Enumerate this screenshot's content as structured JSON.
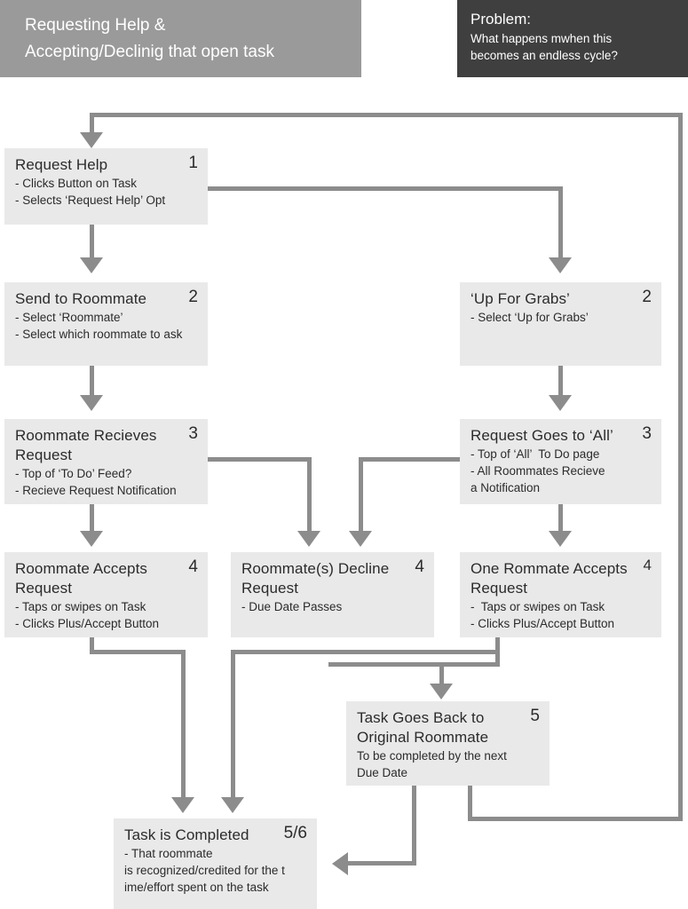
{
  "headers": {
    "left": {
      "line1": "Requesting Help &",
      "line2": "Accepting/Declinig that open task"
    },
    "right": {
      "title": "Problem:",
      "line1": "What happens mwhen this",
      "line2": "becomes an endless cycle?"
    }
  },
  "colors": {
    "header_left_bg": "#9a9a9a",
    "header_right_bg": "#3f3f3f",
    "box_bg": "#e9e9e9",
    "connector": "#8c8c8c",
    "text": "#2b2b2b"
  },
  "nodes": [
    {
      "id": "request-help",
      "number": "1",
      "title": "Request Help",
      "lines": [
        "- Clicks Button on Task",
        "- Selects ‘Request Help’ Opt"
      ]
    },
    {
      "id": "send-to-roommate",
      "number": "2",
      "title": "Send to Roommate",
      "lines": [
        "- Select ‘Roommate’",
        "- Select which roommate to ask"
      ]
    },
    {
      "id": "up-for-grabs",
      "number": "2",
      "title": "‘Up For Grabs’",
      "lines": [
        "- Select ‘Up for Grabs’"
      ]
    },
    {
      "id": "roommate-recieves-request",
      "number": "3",
      "title": "Roommate Recieves",
      "title2": "Request",
      "lines": [
        "- Top of ‘To Do’ Feed?",
        "- Recieve Request Notification"
      ]
    },
    {
      "id": "request-goes-to-all",
      "number": "3",
      "title": "Request Goes to ‘All’",
      "lines": [
        "- Top of ‘All’  To Do page",
        "- All Roommates Recieve",
        "a Notification"
      ]
    },
    {
      "id": "roommate-accepts-request",
      "number": "4",
      "title": "Roommate Accepts",
      "title2": "Request",
      "lines": [
        "- Taps or swipes on Task",
        "- Clicks Plus/Accept Button"
      ]
    },
    {
      "id": "roommates-decline-request",
      "number": "4",
      "title": "Roommate(s) Decline",
      "title2": "Request",
      "lines": [
        "- Due Date Passes"
      ]
    },
    {
      "id": "one-rommate-accepts-request",
      "number": "4",
      "title": "One Rommate Accepts",
      "title2": "Request",
      "lines": [
        "-  Taps or swipes on Task",
        "- Clicks Plus/Accept Button"
      ]
    },
    {
      "id": "task-goes-back",
      "number": "5",
      "title": "Task Goes Back to",
      "title2": "Original Roommate",
      "lines": [
        "To be completed by the next",
        "Due Date"
      ]
    },
    {
      "id": "task-is-completed",
      "number": "5/6",
      "title": "Task is Completed",
      "lines": [
        "- That roommate",
        "is recognized/credited for the t",
        "ime/effort spent on the task"
      ]
    }
  ]
}
